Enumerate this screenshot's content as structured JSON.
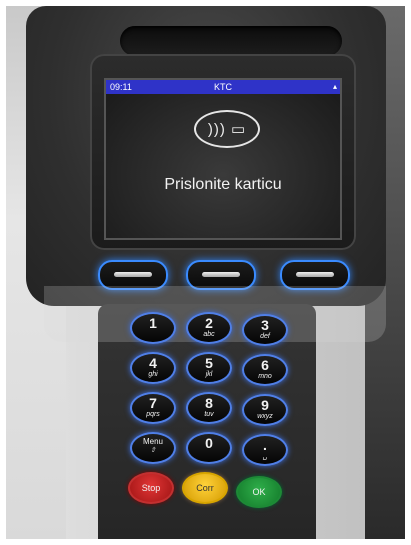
{
  "screen": {
    "time": "09:11",
    "title": "KTC",
    "signal_icon": "signal-icon",
    "contactless_icon": "contactless-card-icon",
    "prompt": "Prislonite karticu"
  },
  "softkeys": [
    "left",
    "center",
    "right"
  ],
  "keypad": {
    "keys": [
      {
        "digit": "1",
        "letters": ""
      },
      {
        "digit": "2",
        "letters": "abc"
      },
      {
        "digit": "3",
        "letters": "def"
      },
      {
        "digit": "4",
        "letters": "ghi"
      },
      {
        "digit": "5",
        "letters": "jkl"
      },
      {
        "digit": "6",
        "letters": "mno"
      },
      {
        "digit": "7",
        "letters": "pqrs"
      },
      {
        "digit": "8",
        "letters": "tuv"
      },
      {
        "digit": "9",
        "letters": "wxyz"
      },
      {
        "digit": "Menu",
        "letters": "⇧"
      },
      {
        "digit": "0",
        "letters": ""
      },
      {
        "digit": ".",
        "letters": "␣"
      }
    ],
    "stop_label": "Stop",
    "corr_label": "Corr",
    "ok_label": "OK",
    "colors": {
      "stop": "#c62828",
      "corr": "#f2b705",
      "ok": "#1f9a3a",
      "key_glow": "#3c6fe0"
    }
  }
}
